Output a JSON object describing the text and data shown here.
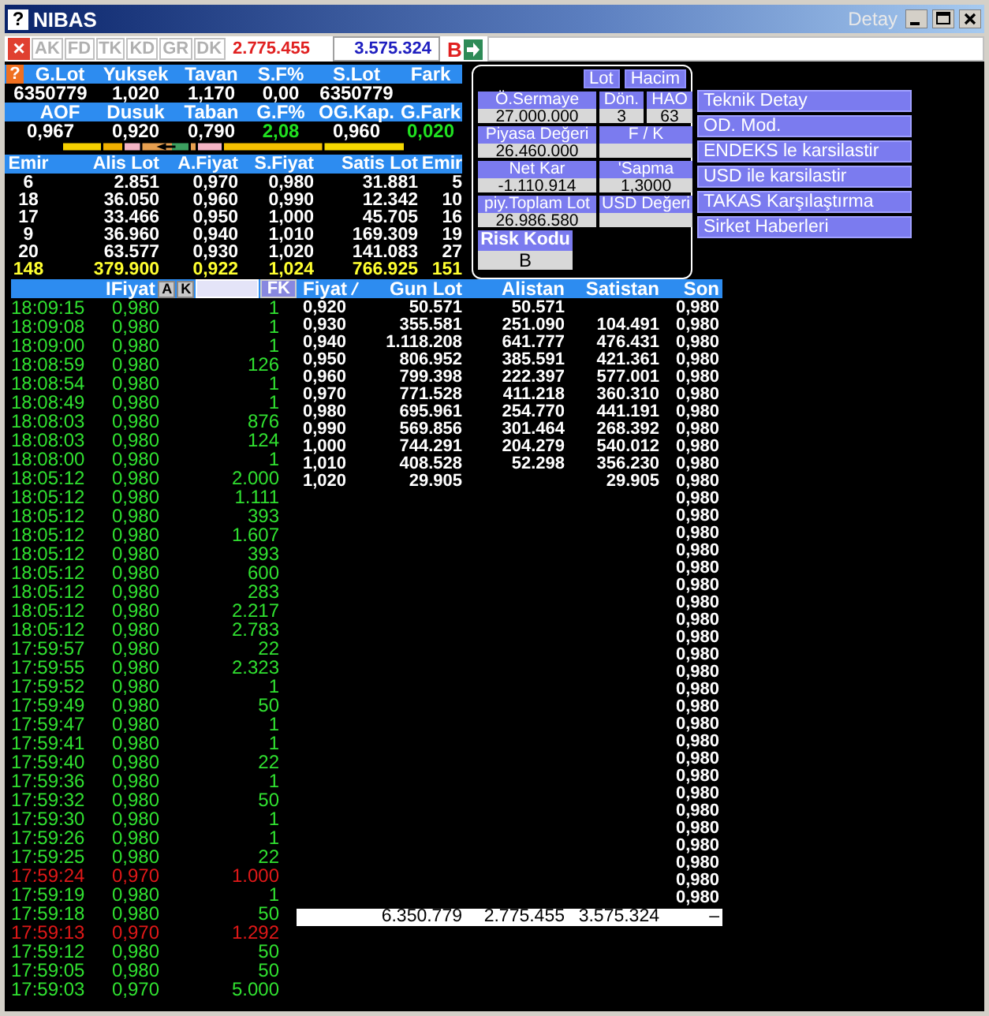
{
  "window": {
    "help_glyph": "?",
    "title": "NIBAS",
    "caption": "Detay"
  },
  "toolbar": {
    "close_glyph": "×",
    "tabs": [
      {
        "label": "AK",
        "disabled": true
      },
      {
        "label": "FD",
        "disabled": true
      },
      {
        "label": "TK",
        "disabled": true
      },
      {
        "label": "KD",
        "disabled": true
      },
      {
        "label": "GR",
        "disabled": true
      },
      {
        "label": "DK",
        "disabled": true
      }
    ],
    "buy_total": "2.775.455",
    "sell_total": "3.575.324",
    "mark": "B"
  },
  "summary": {
    "help_glyph": "?",
    "groups": [
      {
        "headers": [
          "G.Lot",
          "Yuksek",
          "Tavan",
          "S.F%",
          "S.Lot",
          "Fark"
        ],
        "values": [
          {
            "text": "6350779",
            "kind": "plain"
          },
          {
            "text": "1,020",
            "kind": "plain"
          },
          {
            "text": "1,170",
            "kind": "plain"
          },
          {
            "text": "0,00",
            "kind": "plain"
          },
          {
            "text": "6350779",
            "kind": "plain"
          }
        ]
      },
      {
        "headers": [
          "AOF",
          "Dusuk",
          "Taban",
          "G.F%",
          "OG.Kap.",
          "G.Fark"
        ],
        "values": [
          {
            "text": "0,967",
            "kind": "plain"
          },
          {
            "text": "0,920",
            "kind": "plain"
          },
          {
            "text": "0,790",
            "kind": "plain"
          },
          {
            "text": "2,08",
            "kind": "up"
          },
          {
            "text": "0,960",
            "kind": "plain"
          },
          {
            "text": "0,020",
            "kind": "up"
          }
        ]
      }
    ]
  },
  "depth": {
    "columns": [
      "Emir",
      "Alis Lot",
      "A.Fiyat",
      "S.Fiyat",
      "Satis Lot",
      "Emir"
    ],
    "rows": [
      {
        "kind": "level",
        "cells": [
          "6",
          "2.851",
          "0,970",
          "0,980",
          "31.881",
          "5"
        ]
      },
      {
        "kind": "level",
        "cells": [
          "18",
          "36.050",
          "0,960",
          "0,990",
          "12.342",
          "10"
        ]
      },
      {
        "kind": "level",
        "cells": [
          "17",
          "33.466",
          "0,950",
          "1,000",
          "45.705",
          "16"
        ]
      },
      {
        "kind": "level",
        "cells": [
          "9",
          "36.960",
          "0,940",
          "1,010",
          "169.309",
          "19"
        ]
      },
      {
        "kind": "level",
        "cells": [
          "20",
          "63.577",
          "0,930",
          "1,020",
          "141.083",
          "27"
        ]
      },
      {
        "kind": "total",
        "cells": [
          "148",
          "379.900",
          "0,922",
          "1,024",
          "766.925",
          "151"
        ]
      }
    ]
  },
  "fundamentals": {
    "buttons": [
      "Lot",
      "Hacim"
    ],
    "rows": [
      {
        "fields": [
          {
            "label": "Ö.Sermaye",
            "value": "27.000.000"
          },
          {
            "label": "Dön.",
            "value": "3"
          },
          {
            "label": "HAO",
            "value": "63"
          }
        ]
      },
      {
        "fields": [
          {
            "label": "Piyasa Değeri",
            "value": "26.460.000"
          },
          {
            "label": "F / K"
          }
        ]
      },
      {
        "fields": [
          {
            "label": "Net Kar",
            "value": "-1.110.914"
          },
          {
            "label": "'Sapma",
            "value": "1,3000"
          }
        ]
      },
      {
        "fields": [
          {
            "label": "piy.Toplam Lot",
            "value": "26.986.580"
          },
          {
            "label": "USD Değeri"
          }
        ]
      },
      {
        "fields": [
          {
            "label": "Risk Kodu",
            "value": "B"
          }
        ]
      }
    ]
  },
  "actions": [
    "Teknik Detay",
    "OD. Mod.",
    "ENDEKS le karsilastir",
    "USD ile karsilastir",
    "TAKAS Karşılaştırma",
    "Sirket Haberleri"
  ],
  "trades": {
    "header": "IFiyat",
    "buttons": [
      "A",
      "K"
    ],
    "filter_button": "FK",
    "rows": [
      {
        "time": "18:09:15",
        "price": "0,980",
        "lot": "1",
        "kind": "up"
      },
      {
        "time": "18:09:08",
        "price": "0,980",
        "lot": "1",
        "kind": "up"
      },
      {
        "time": "18:09:00",
        "price": "0,980",
        "lot": "1",
        "kind": "up"
      },
      {
        "time": "18:08:59",
        "price": "0,980",
        "lot": "126",
        "kind": "up"
      },
      {
        "time": "18:08:54",
        "price": "0,980",
        "lot": "1",
        "kind": "up"
      },
      {
        "time": "18:08:49",
        "price": "0,980",
        "lot": "1",
        "kind": "up"
      },
      {
        "time": "18:08:03",
        "price": "0,980",
        "lot": "876",
        "kind": "up"
      },
      {
        "time": "18:08:03",
        "price": "0,980",
        "lot": "124",
        "kind": "up"
      },
      {
        "time": "18:08:00",
        "price": "0,980",
        "lot": "1",
        "kind": "up"
      },
      {
        "time": "18:05:12",
        "price": "0,980",
        "lot": "2.000",
        "kind": "up"
      },
      {
        "time": "18:05:12",
        "price": "0,980",
        "lot": "1.111",
        "kind": "up"
      },
      {
        "time": "18:05:12",
        "price": "0,980",
        "lot": "393",
        "kind": "up"
      },
      {
        "time": "18:05:12",
        "price": "0,980",
        "lot": "1.607",
        "kind": "up"
      },
      {
        "time": "18:05:12",
        "price": "0,980",
        "lot": "393",
        "kind": "up"
      },
      {
        "time": "18:05:12",
        "price": "0,980",
        "lot": "600",
        "kind": "up"
      },
      {
        "time": "18:05:12",
        "price": "0,980",
        "lot": "283",
        "kind": "up"
      },
      {
        "time": "18:05:12",
        "price": "0,980",
        "lot": "2.217",
        "kind": "up"
      },
      {
        "time": "18:05:12",
        "price": "0,980",
        "lot": "2.783",
        "kind": "up"
      },
      {
        "time": "17:59:57",
        "price": "0,980",
        "lot": "22",
        "kind": "up"
      },
      {
        "time": "17:59:55",
        "price": "0,980",
        "lot": "2.323",
        "kind": "up"
      },
      {
        "time": "17:59:52",
        "price": "0,980",
        "lot": "1",
        "kind": "up"
      },
      {
        "time": "17:59:49",
        "price": "0,980",
        "lot": "50",
        "kind": "up"
      },
      {
        "time": "17:59:47",
        "price": "0,980",
        "lot": "1",
        "kind": "up"
      },
      {
        "time": "17:59:41",
        "price": "0,980",
        "lot": "1",
        "kind": "up"
      },
      {
        "time": "17:59:40",
        "price": "0,980",
        "lot": "22",
        "kind": "up"
      },
      {
        "time": "17:59:36",
        "price": "0,980",
        "lot": "1",
        "kind": "up"
      },
      {
        "time": "17:59:32",
        "price": "0,980",
        "lot": "50",
        "kind": "up"
      },
      {
        "time": "17:59:30",
        "price": "0,980",
        "lot": "1",
        "kind": "up"
      },
      {
        "time": "17:59:26",
        "price": "0,980",
        "lot": "1",
        "kind": "up"
      },
      {
        "time": "17:59:25",
        "price": "0,980",
        "lot": "22",
        "kind": "up"
      },
      {
        "time": "17:59:24",
        "price": "0,970",
        "lot": "1.000",
        "kind": "down"
      },
      {
        "time": "17:59:19",
        "price": "0,980",
        "lot": "1",
        "kind": "up"
      },
      {
        "time": "17:59:18",
        "price": "0,980",
        "lot": "50",
        "kind": "up"
      },
      {
        "time": "17:59:13",
        "price": "0,970",
        "lot": "1.292",
        "kind": "down"
      },
      {
        "time": "17:59:12",
        "price": "0,980",
        "lot": "50",
        "kind": "up"
      },
      {
        "time": "17:59:05",
        "price": "0,980",
        "lot": "50",
        "kind": "up"
      },
      {
        "time": "17:59:03",
        "price": "0,970",
        "lot": "5.000",
        "kind": "up"
      }
    ]
  },
  "price_table": {
    "columns": [
      "Fiyat",
      "Gun Lot",
      "Alistan",
      "Satistan",
      "Son"
    ],
    "rows": [
      {
        "fiyat": "0,920",
        "gun_lot": "50.571",
        "alistan": "50.571",
        "son": "0,980"
      },
      {
        "fiyat": "0,930",
        "gun_lot": "355.581",
        "alistan": "251.090",
        "satistan": "104.491",
        "son": "0,980"
      },
      {
        "fiyat": "0,940",
        "gun_lot": "1.118.208",
        "alistan": "641.777",
        "satistan": "476.431",
        "son": "0,980"
      },
      {
        "fiyat": "0,950",
        "gun_lot": "806.952",
        "alistan": "385.591",
        "satistan": "421.361",
        "son": "0,980"
      },
      {
        "fiyat": "0,960",
        "gun_lot": "799.398",
        "alistan": "222.397",
        "satistan": "577.001",
        "son": "0,980"
      },
      {
        "fiyat": "0,970",
        "gun_lot": "771.528",
        "alistan": "411.218",
        "satistan": "360.310",
        "son": "0,980"
      },
      {
        "fiyat": "0,980",
        "gun_lot": "695.961",
        "alistan": "254.770",
        "satistan": "441.191",
        "son": "0,980"
      },
      {
        "fiyat": "0,990",
        "gun_lot": "569.856",
        "alistan": "301.464",
        "satistan": "268.392",
        "son": "0,980"
      },
      {
        "fiyat": "1,000",
        "gun_lot": "744.291",
        "alistan": "204.279",
        "satistan": "540.012",
        "son": "0,980"
      },
      {
        "fiyat": "1,010",
        "gun_lot": "408.528",
        "alistan": "52.298",
        "satistan": "356.230",
        "son": "0,980"
      },
      {
        "fiyat": "1,020",
        "gun_lot": "29.905",
        "satistan": "29.905",
        "son": "0,980"
      },
      {
        "son": "0,980"
      },
      {
        "son": "0,980"
      },
      {
        "son": "0,980"
      },
      {
        "son": "0,980"
      },
      {
        "son": "0,980"
      },
      {
        "son": "0,980"
      },
      {
        "son": "0,980"
      },
      {
        "son": "0,980"
      },
      {
        "son": "0,980"
      },
      {
        "son": "0,980"
      },
      {
        "son": "0,980"
      },
      {
        "son": "0,980"
      },
      {
        "son": "0,980"
      },
      {
        "son": "0,980"
      },
      {
        "son": "0,980"
      },
      {
        "son": "0,980"
      },
      {
        "son": "0,980"
      },
      {
        "son": "0,980"
      },
      {
        "son": "0,980"
      },
      {
        "son": "0,980"
      },
      {
        "son": "0,980"
      },
      {
        "son": "0,980"
      },
      {
        "son": "0,980"
      },
      {
        "son": "0,980"
      }
    ],
    "totals": {
      "gun_lot": "6.350.779",
      "alistan": "2.775.455",
      "satistan": "3.575.324",
      "son": "–"
    }
  }
}
